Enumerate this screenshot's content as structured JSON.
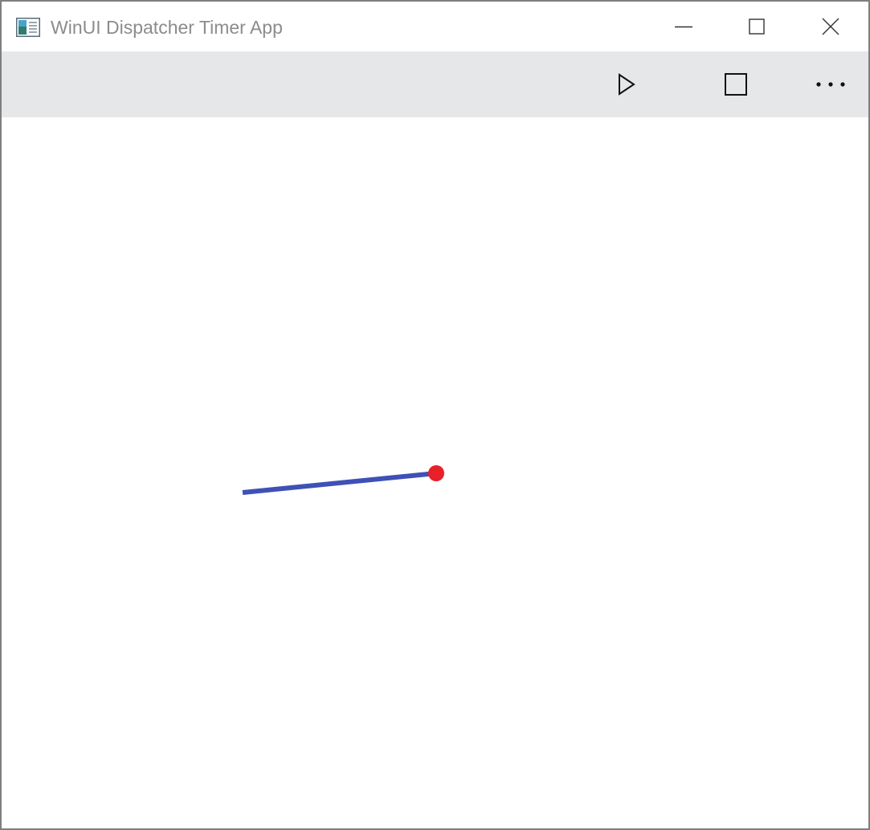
{
  "window": {
    "title": "WinUI Dispatcher Timer App",
    "app_icon": "app-window-icon",
    "caption_buttons": [
      "minimize-icon",
      "maximize-icon",
      "close-icon"
    ]
  },
  "commandbar": {
    "buttons": [
      {
        "name": "play",
        "icon": "play-icon"
      },
      {
        "name": "stop",
        "icon": "stop-icon"
      },
      {
        "name": "more",
        "icon": "more-icon"
      }
    ]
  },
  "canvas": {
    "line_color": "#3f51b5",
    "dot_color": "#e8202a"
  }
}
